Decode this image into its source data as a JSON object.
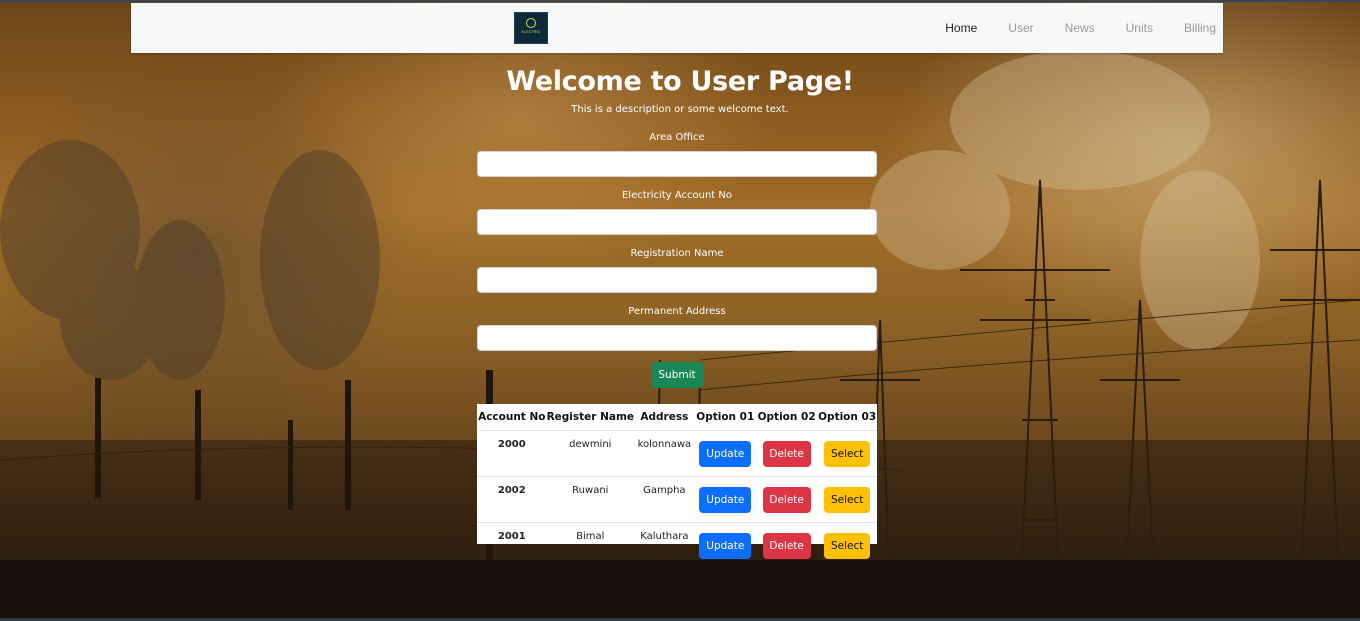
{
  "nav": {
    "logo_text": "ELECTRIC",
    "items": [
      {
        "label": "Home"
      },
      {
        "label": "User"
      },
      {
        "label": "News"
      },
      {
        "label": "Units"
      },
      {
        "label": "Billing"
      }
    ]
  },
  "page": {
    "title": "Welcome to User Page!",
    "subtitle": "This is a description or some welcome text."
  },
  "form": {
    "fields": [
      {
        "label": "Area Office",
        "value": ""
      },
      {
        "label": "Electricity Account No",
        "value": ""
      },
      {
        "label": "Registration Name",
        "value": ""
      },
      {
        "label": "Permanent Address",
        "value": ""
      }
    ],
    "submit_label": "Submit"
  },
  "table": {
    "headers": [
      "Account No",
      "Register Name",
      "Address",
      "Option 01",
      "Option 02",
      "Option 03"
    ],
    "rows": [
      {
        "account": "2000",
        "name": "dewmini",
        "address": "kolonnawa",
        "update": "Update",
        "delete": "Delete",
        "select": "Select"
      },
      {
        "account": "2002",
        "name": "Ruwani",
        "address": "Gampha",
        "update": "Update",
        "delete": "Delete",
        "select": "Select"
      },
      {
        "account": "2001",
        "name": "Bimal",
        "address": "Kaluthara",
        "update": "Update",
        "delete": "Delete",
        "select": "Select"
      }
    ]
  },
  "colors": {
    "navbar_bg": "#f7f8fa",
    "submit": "#198754",
    "update": "#0d6efd",
    "delete": "#dc3545",
    "select": "#ffc107"
  }
}
